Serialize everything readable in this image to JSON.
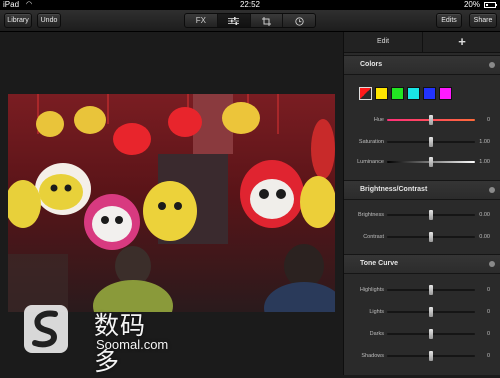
{
  "status": {
    "device": "iPad",
    "time": "22:52",
    "battery": "20%"
  },
  "toolbar": {
    "library": "Library",
    "undo": "Undo",
    "fx": "FX",
    "edits": "Edits",
    "share": "Share"
  },
  "panel": {
    "tab_edit": "Edit",
    "tab_plus": "+",
    "colors": {
      "title": "Colors",
      "swatches": [
        "#ff1a1a",
        "#ffe600",
        "#22e622",
        "#19e6e6",
        "#2233ff",
        "#ff1aff"
      ],
      "hue": {
        "label": "Hue",
        "value": "0",
        "level": 0.5
      },
      "saturation": {
        "label": "Saturation",
        "value": "1.00",
        "level": 0.5
      },
      "luminance": {
        "label": "Luminance",
        "value": "1.00",
        "level": 0.5
      }
    },
    "brightness_contrast": {
      "title": "Brightness/Contrast",
      "brightness": {
        "label": "Brightness",
        "value": "0.00",
        "level": 0.5
      },
      "contrast": {
        "label": "Contrast",
        "value": "0.00",
        "level": 0.5
      }
    },
    "tone_curve": {
      "title": "Tone Curve",
      "highlights": {
        "label": "Highlights",
        "value": "0",
        "level": 0.5
      },
      "lights": {
        "label": "Lights",
        "value": "0",
        "level": 0.5
      },
      "darks": {
        "label": "Darks",
        "value": "0",
        "level": 0.5
      },
      "shadows": {
        "label": "Shadows",
        "value": "0",
        "level": 0.5
      }
    }
  },
  "watermark": {
    "cn": "数码多",
    "en": "Soomal.com"
  },
  "icons": {
    "wifi": "wifi-icon",
    "adjust": "sliders-icon",
    "crop": "crop-icon",
    "info": "clock-icon"
  }
}
